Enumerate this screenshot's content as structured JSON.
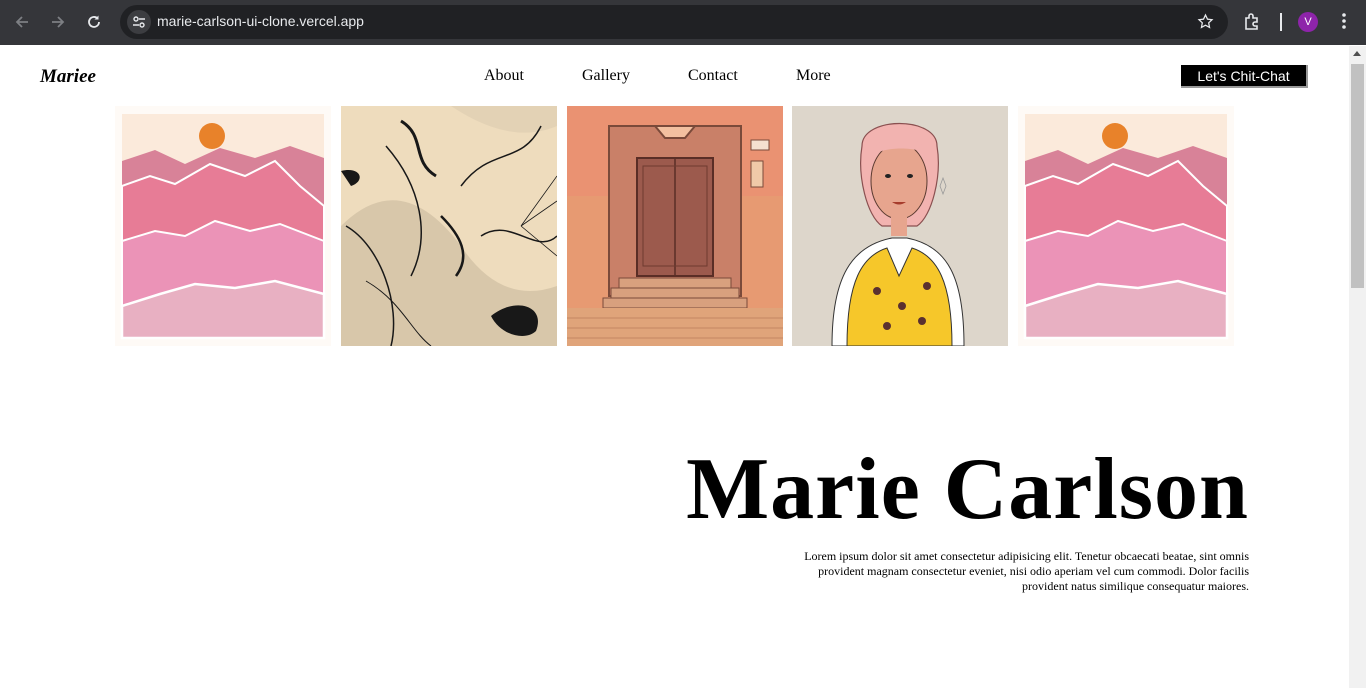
{
  "browser": {
    "url": "marie-carlson-ui-clone.vercel.app",
    "profile_initial": "V",
    "icons": [
      "back-icon",
      "forward-icon",
      "reload-icon",
      "site-settings-icon",
      "bookmark-star-icon",
      "extensions-icon",
      "more-menu-icon"
    ]
  },
  "header": {
    "logo": "Mariee",
    "nav": [
      "About",
      "Gallery",
      "Contact",
      "More"
    ],
    "cta": "Let's Chit-Chat"
  },
  "gallery": {
    "items": [
      "mountains-artwork",
      "floral-line-artwork",
      "door-artwork",
      "girl-portrait-artwork",
      "mountains-artwork"
    ]
  },
  "hero": {
    "title": "Marie Carlson",
    "text": "Lorem ipsum dolor sit amet consectetur adipisicing elit. Tenetur obcaecati beatae, sint omnis provident magnam consectetur eveniet, nisi odio aperiam vel cum commodi. Dolor facilis provident natus similique consequatur maiores."
  },
  "colors": {
    "accent_orange": "#e8822a",
    "pink_dark": "#d88298",
    "pink_mid": "#e77c96",
    "pink_light": "#eda3bd",
    "cream": "#fbeadb",
    "chrome_bg": "#35363a",
    "avatar_bg": "#8e24aa"
  }
}
